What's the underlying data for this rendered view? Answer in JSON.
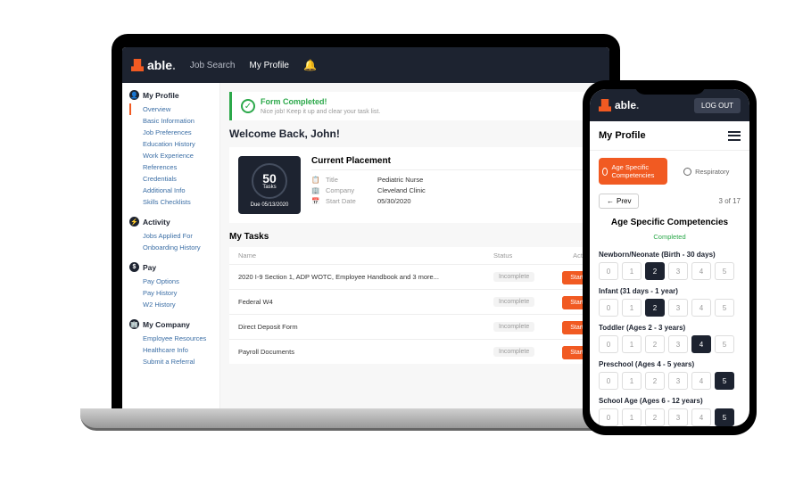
{
  "brand": "able",
  "desktop": {
    "nav": {
      "job_search": "Job Search",
      "my_profile": "My Profile"
    },
    "sidebar": {
      "profile": {
        "head": "My Profile",
        "items": [
          "Overview",
          "Basic Information",
          "Job Preferences",
          "Education History",
          "Work Experience",
          "References",
          "Credentials",
          "Additional Info",
          "Skills Checklists"
        ]
      },
      "activity": {
        "head": "Activity",
        "items": [
          "Jobs Applied For",
          "Onboarding History"
        ]
      },
      "pay": {
        "head": "Pay",
        "items": [
          "Pay Options",
          "Pay History",
          "W2 History"
        ]
      },
      "company": {
        "head": "My Company",
        "items": [
          "Employee Resources",
          "Healthcare Info",
          "Submit a Referral"
        ]
      }
    },
    "banner": {
      "title": "Form Completed!",
      "subtitle": "Nice job! Keep it up and clear your task list."
    },
    "welcome": "Welcome Back, John!",
    "placement": {
      "title": "Current Placement",
      "tasks_count": "50",
      "tasks_label": "Tasks",
      "due_label": "Due",
      "due_date": "05/13/2020",
      "rows": [
        {
          "label": "Title",
          "value": "Pediatric Nurse"
        },
        {
          "label": "Company",
          "value": "Cleveland Clinic"
        },
        {
          "label": "Start Date",
          "value": "05/30/2020"
        }
      ]
    },
    "tasks": {
      "title": "My Tasks",
      "columns": {
        "name": "Name",
        "status": "Status",
        "action": "Action"
      },
      "status_label": "Incomplete",
      "action_label": "Start",
      "rows": [
        "2020 I-9 Section 1, ADP WOTC, Employee Handbook and 3 more...",
        "Federal W4",
        "Direct Deposit Form",
        "Payroll Documents"
      ]
    }
  },
  "mobile": {
    "logout": "LOG OUT",
    "page_title": "My Profile",
    "tabs": {
      "active": "Age Specific Competencies",
      "inactive": "Respiratory"
    },
    "prev": "Prev",
    "pager": "3 of 17",
    "section": {
      "title": "Age Specific Competencies",
      "status": "Completed"
    },
    "scales": [
      {
        "label": "Newborn/Neonate (Birth - 30 days)",
        "selected": 2
      },
      {
        "label": "Infant (31 days - 1 year)",
        "selected": 2
      },
      {
        "label": "Toddler (Ages 2 - 3 years)",
        "selected": 4
      },
      {
        "label": "Preschool (Ages 4 - 5 years)",
        "selected": 5
      },
      {
        "label": "School Age (Ages 6 - 12 years)",
        "selected": 5
      }
    ],
    "scale_options": [
      "0",
      "1",
      "2",
      "3",
      "4",
      "5"
    ]
  }
}
